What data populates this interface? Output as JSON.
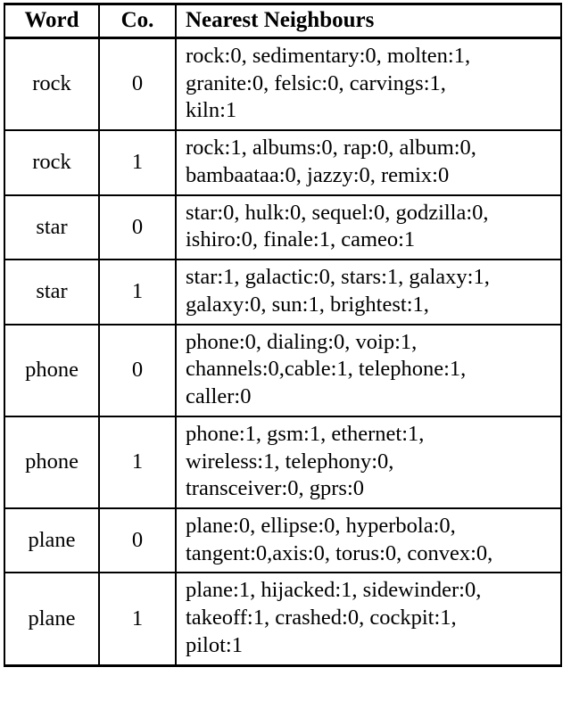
{
  "table": {
    "columns": [
      "Word",
      "Co.",
      "Nearest Neighbours"
    ],
    "rows": [
      {
        "word": "rock",
        "co": "0",
        "neighbours_lines": [
          "rock:0, sedimentary:0, molten:1,",
          "granite:0, felsic:0, carvings:1,",
          "kiln:1"
        ],
        "neighbours_text": "rock:0, sedimentary:0, molten:1, granite:0, felsic:0, carvings:1, kiln:1",
        "neighbours": [
          {
            "word": "rock",
            "sense": "0"
          },
          {
            "word": "sedimentary",
            "sense": "0"
          },
          {
            "word": "molten",
            "sense": "1"
          },
          {
            "word": "granite",
            "sense": "0"
          },
          {
            "word": "felsic",
            "sense": "0"
          },
          {
            "word": "carvings",
            "sense": "1"
          },
          {
            "word": "kiln",
            "sense": "1"
          }
        ]
      },
      {
        "word": "rock",
        "co": "1",
        "neighbours_lines": [
          "rock:1, albums:0, rap:0, album:0,",
          "bambaataa:0, jazzy:0, remix:0"
        ],
        "neighbours_text": "rock:1, albums:0, rap:0, album:0, bambaataa:0, jazzy:0, remix:0",
        "neighbours": [
          {
            "word": "rock",
            "sense": "1"
          },
          {
            "word": "albums",
            "sense": "0"
          },
          {
            "word": "rap",
            "sense": "0"
          },
          {
            "word": "album",
            "sense": "0"
          },
          {
            "word": "bambaataa",
            "sense": "0"
          },
          {
            "word": "jazzy",
            "sense": "0"
          },
          {
            "word": "remix",
            "sense": "0"
          }
        ]
      },
      {
        "word": "star",
        "co": "0",
        "neighbours_lines": [
          "star:0, hulk:0, sequel:0, godzilla:0,",
          "ishiro:0, finale:1, cameo:1"
        ],
        "neighbours_text": "star:0, hulk:0, sequel:0, godzilla:0, ishiro:0, finale:1, cameo:1",
        "neighbours": [
          {
            "word": "star",
            "sense": "0"
          },
          {
            "word": "hulk",
            "sense": "0"
          },
          {
            "word": "sequel",
            "sense": "0"
          },
          {
            "word": "godzilla",
            "sense": "0"
          },
          {
            "word": "ishiro",
            "sense": "0"
          },
          {
            "word": "finale",
            "sense": "1"
          },
          {
            "word": "cameo",
            "sense": "1"
          }
        ]
      },
      {
        "word": "star",
        "co": "1",
        "neighbours_lines": [
          "star:1, galactic:0, stars:1, galaxy:1,",
          "galaxy:0, sun:1, brightest:1,"
        ],
        "neighbours_text": "star:1, galactic:0, stars:1, galaxy:1, galaxy:0, sun:1, brightest:1,",
        "neighbours": [
          {
            "word": "star",
            "sense": "1"
          },
          {
            "word": "galactic",
            "sense": "0"
          },
          {
            "word": "stars",
            "sense": "1"
          },
          {
            "word": "galaxy",
            "sense": "1"
          },
          {
            "word": "galaxy",
            "sense": "0"
          },
          {
            "word": "sun",
            "sense": "1"
          },
          {
            "word": "brightest",
            "sense": "1"
          }
        ]
      },
      {
        "word": "phone",
        "co": "0",
        "neighbours_lines": [
          "phone:0, dialing:0, voip:1,",
          "channels:0,cable:1, telephone:1,",
          "caller:0"
        ],
        "neighbours_text": "phone:0, dialing:0, voip:1, channels:0,cable:1, telephone:1, caller:0",
        "neighbours": [
          {
            "word": "phone",
            "sense": "0"
          },
          {
            "word": "dialing",
            "sense": "0"
          },
          {
            "word": "voip",
            "sense": "1"
          },
          {
            "word": "channels",
            "sense": "0"
          },
          {
            "word": "cable",
            "sense": "1"
          },
          {
            "word": "telephone",
            "sense": "1"
          },
          {
            "word": "caller",
            "sense": "0"
          }
        ]
      },
      {
        "word": "phone",
        "co": "1",
        "neighbours_lines": [
          "phone:1, gsm:1, ethernet:1,",
          "wireless:1, telephony:0,",
          "transceiver:0, gprs:0"
        ],
        "neighbours_text": "phone:1, gsm:1, ethernet:1, wireless:1, telephony:0, transceiver:0, gprs:0",
        "neighbours": [
          {
            "word": "phone",
            "sense": "1"
          },
          {
            "word": "gsm",
            "sense": "1"
          },
          {
            "word": "ethernet",
            "sense": "1"
          },
          {
            "word": "wireless",
            "sense": "1"
          },
          {
            "word": "telephony",
            "sense": "0"
          },
          {
            "word": "transceiver",
            "sense": "0"
          },
          {
            "word": "gprs",
            "sense": "0"
          }
        ]
      },
      {
        "word": "plane",
        "co": "0",
        "neighbours_lines": [
          "plane:0, ellipse:0, hyperbola:0,",
          "tangent:0,axis:0, torus:0, convex:0,"
        ],
        "neighbours_text": "plane:0, ellipse:0, hyperbola:0, tangent:0,axis:0, torus:0, convex:0,",
        "neighbours": [
          {
            "word": "plane",
            "sense": "0"
          },
          {
            "word": "ellipse",
            "sense": "0"
          },
          {
            "word": "hyperbola",
            "sense": "0"
          },
          {
            "word": "tangent",
            "sense": "0"
          },
          {
            "word": "axis",
            "sense": "0"
          },
          {
            "word": "torus",
            "sense": "0"
          },
          {
            "word": "convex",
            "sense": "0"
          }
        ]
      },
      {
        "word": "plane",
        "co": "1",
        "neighbours_lines": [
          "plane:1, hijacked:1, sidewinder:0,",
          "takeoff:1, crashed:0, cockpit:1,",
          "pilot:1"
        ],
        "neighbours_text": "plane:1, hijacked:1, sidewinder:0, takeoff:1, crashed:0, cockpit:1, pilot:1",
        "neighbours": [
          {
            "word": "plane",
            "sense": "1"
          },
          {
            "word": "hijacked",
            "sense": "1"
          },
          {
            "word": "sidewinder",
            "sense": "0"
          },
          {
            "word": "takeoff",
            "sense": "1"
          },
          {
            "word": "crashed",
            "sense": "0"
          },
          {
            "word": "cockpit",
            "sense": "1"
          },
          {
            "word": "pilot",
            "sense": "1"
          }
        ]
      }
    ]
  }
}
